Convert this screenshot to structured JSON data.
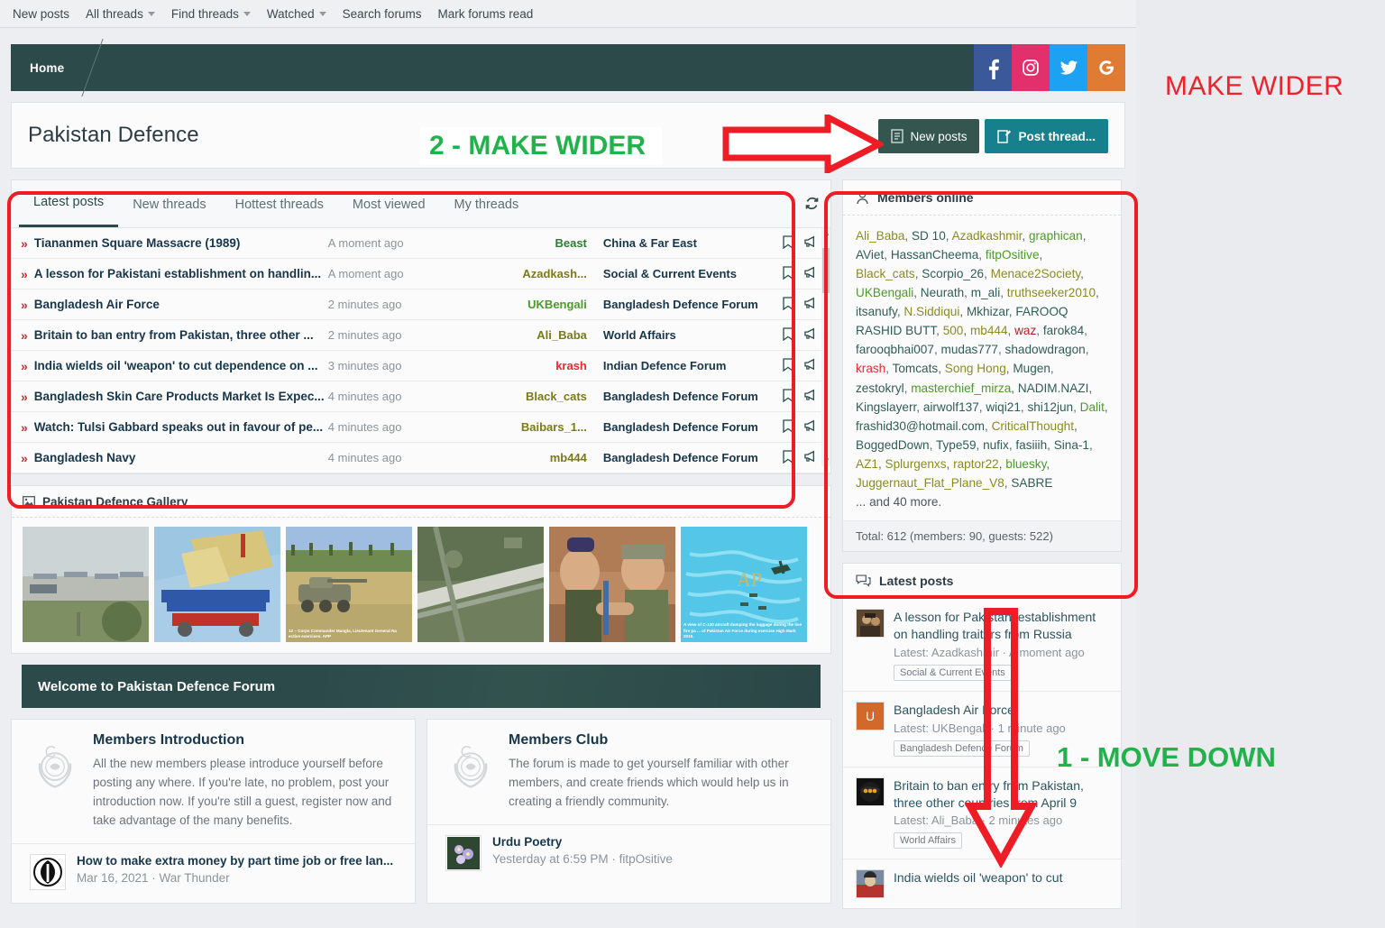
{
  "topnav": {
    "items": [
      {
        "label": "New posts",
        "caret": false
      },
      {
        "label": "All threads",
        "caret": true
      },
      {
        "label": "Find threads",
        "caret": true
      },
      {
        "label": "Watched",
        "caret": true
      },
      {
        "label": "Search forums",
        "caret": false
      },
      {
        "label": "Mark forums read",
        "caret": false
      }
    ]
  },
  "breadcrumb": {
    "home": "Home"
  },
  "socials": [
    {
      "name": "facebook",
      "glyph": "f",
      "color": "#3b5998"
    },
    {
      "name": "instagram",
      "glyph": "",
      "color": "#e1306c"
    },
    {
      "name": "twitter",
      "glyph": "",
      "color": "#1da1f2"
    },
    {
      "name": "google",
      "glyph": "G",
      "color": "#e07b33"
    }
  ],
  "header": {
    "title": "Pakistan Defence",
    "new_posts_label": "New posts",
    "post_thread_label": "Post thread..."
  },
  "tabs": [
    {
      "label": "Latest posts",
      "active": true
    },
    {
      "label": "New threads",
      "active": false
    },
    {
      "label": "Hottest threads",
      "active": false
    },
    {
      "label": "Most viewed",
      "active": false
    },
    {
      "label": "My threads",
      "active": false
    }
  ],
  "threads": [
    {
      "title": "Tiananmen Square Massacre (1989)",
      "time": "A moment ago",
      "user": "Beast",
      "user_color": "#2e7d32",
      "forum": "China & Far East"
    },
    {
      "title": "A lesson for Pakistani establishment on handlin...",
      "time": "A moment ago",
      "user": "Azadkash...",
      "user_color": "#7a7b18",
      "forum": "Social & Current Events"
    },
    {
      "title": "Bangladesh Air Force",
      "time": "2 minutes ago",
      "user": "UKBengali",
      "user_color": "#4c9a2a",
      "forum": "Bangladesh Defence Forum"
    },
    {
      "title": "Britain to ban entry from Pakistan, three other ...",
      "time": "2 minutes ago",
      "user": "Ali_Baba",
      "user_color": "#7a7b18",
      "forum": "World Affairs"
    },
    {
      "title": "India wields oil 'weapon' to cut dependence on ...",
      "time": "3 minutes ago",
      "user": "krash",
      "user_color": "#e8292f",
      "forum": "Indian Defence Forum"
    },
    {
      "title": "Bangladesh Skin Care Products Market Is Expec...",
      "time": "4 minutes ago",
      "user": "Black_cats",
      "user_color": "#7a7b18",
      "forum": "Bangladesh Defence Forum"
    },
    {
      "title": "Watch: Tulsi Gabbard speaks out in favour of pe...",
      "time": "4 minutes ago",
      "user": "Baibars_1...",
      "user_color": "#7a7b18",
      "forum": "Bangladesh Defence Forum"
    },
    {
      "title": "Bangladesh Navy",
      "time": "4 minutes ago",
      "user": "mb444",
      "user_color": "#7a7b18",
      "forum": "Bangladesh Defence Forum"
    }
  ],
  "gallery": {
    "title": "Pakistan Defence Gallery",
    "items": [
      {
        "caption": ""
      },
      {
        "caption": ""
      },
      {
        "caption": "12 – Corps Commander Mangla, Lieutenant General Na ective exercises. APP"
      },
      {
        "caption": ""
      },
      {
        "caption": ""
      },
      {
        "caption": "A view of C-130 aircraft dumping the luggage during the live fire pa ... of Pakistan Air Force during exercise High Mark 2010."
      }
    ]
  },
  "welcome": {
    "title": "Welcome to Pakistan Defence Forum"
  },
  "bottom_cards": [
    {
      "title": "Members Introduction",
      "desc": "All the new members please introduce yourself before posting any where. If you're late, no problem, post your introduction now. If you're still a guest, register now and take advantage of the many benefits.",
      "footer_title": "How to make extra money by part time job or free lan...",
      "footer_meta": "Mar 16, 2021 · War Thunder"
    },
    {
      "title": "Members Club",
      "desc": "The forum is made to get yourself familiar with other members, and create friends which would help us in creating a friendly community.",
      "footer_title": "Urdu Poetry",
      "footer_meta": "Yesterday at 6:59 PM · fitpOsitive"
    }
  ],
  "members_online": {
    "title": "Members online",
    "members": [
      {
        "n": "Ali_Baba",
        "c": "#8a8c1e"
      },
      {
        "n": "SD 10",
        "c": "#2f5e52"
      },
      {
        "n": "Azadkashmir",
        "c": "#8a8c1e"
      },
      {
        "n": "graphican",
        "c": "#4c9a2a"
      },
      {
        "n": "AViet",
        "c": "#2f5e52"
      },
      {
        "n": "HassanCheema",
        "c": "#2f5e52"
      },
      {
        "n": "fitpOsitive",
        "c": "#4c9a2a"
      },
      {
        "n": "Black_cats",
        "c": "#8a8c1e"
      },
      {
        "n": "Scorpio_26",
        "c": "#2f5e52"
      },
      {
        "n": "Menace2Society",
        "c": "#8a8c1e"
      },
      {
        "n": "UKBengali",
        "c": "#4c9a2a"
      },
      {
        "n": "Neurath",
        "c": "#2f5e52"
      },
      {
        "n": "m_ali",
        "c": "#2f5e52"
      },
      {
        "n": "truthseeker2010",
        "c": "#8a8c1e"
      },
      {
        "n": "itsanufy",
        "c": "#2f5e52"
      },
      {
        "n": "N.Siddiqui",
        "c": "#8a8c1e"
      },
      {
        "n": "Mkhizar",
        "c": "#2f5e52"
      },
      {
        "n": "FAROOQ RASHID BUTT",
        "c": "#2f5e52"
      },
      {
        "n": "500",
        "c": "#8a8c1e"
      },
      {
        "n": "mb444",
        "c": "#8a8c1e"
      },
      {
        "n": "waz",
        "c": "#b01f24"
      },
      {
        "n": "farok84",
        "c": "#2f5e52"
      },
      {
        "n": "farooqbhai007",
        "c": "#2f5e52"
      },
      {
        "n": "mudas777",
        "c": "#2f5e52"
      },
      {
        "n": "shadowdragon",
        "c": "#2f5e52"
      },
      {
        "n": "krash",
        "c": "#e8292f"
      },
      {
        "n": "Tomcats",
        "c": "#2f5e52"
      },
      {
        "n": "Song Hong",
        "c": "#8a8c1e"
      },
      {
        "n": "Mugen",
        "c": "#2f5e52"
      },
      {
        "n": "zestokryl",
        "c": "#2f5e52"
      },
      {
        "n": "masterchief_mirza",
        "c": "#4c9a2a"
      },
      {
        "n": "NADIM.NAZI",
        "c": "#2f5e52"
      },
      {
        "n": "Kingslayerr",
        "c": "#2f5e52"
      },
      {
        "n": "airwolf137",
        "c": "#2f5e52"
      },
      {
        "n": "wiqi21",
        "c": "#2f5e52"
      },
      {
        "n": "shi12jun",
        "c": "#2f5e52"
      },
      {
        "n": "Dalit",
        "c": "#4c9a2a"
      },
      {
        "n": "frashid30@hotmail.com",
        "c": "#2f5e52"
      },
      {
        "n": "CriticalThought",
        "c": "#8a8c1e"
      },
      {
        "n": "BoggedDown",
        "c": "#2f5e52"
      },
      {
        "n": "Type59",
        "c": "#2f5e52"
      },
      {
        "n": "nufix",
        "c": "#2f5e52"
      },
      {
        "n": "fasiiih",
        "c": "#2f5e52"
      },
      {
        "n": "Sina-1",
        "c": "#2f5e52"
      },
      {
        "n": "AZ1",
        "c": "#8a8c1e"
      },
      {
        "n": "Splurgenxs",
        "c": "#8a8c1e"
      },
      {
        "n": "raptor22",
        "c": "#8a8c1e"
      },
      {
        "n": "bluesky",
        "c": "#4c9a2a"
      },
      {
        "n": "Juggernaut_Flat_Plane_V8",
        "c": "#8a8c1e"
      },
      {
        "n": "SABRE",
        "c": "#2f5e52"
      }
    ],
    "more": "... and 40 more.",
    "total": "Total: 612 (members: 90, guests: 522)"
  },
  "latest_posts": {
    "title": "Latest posts",
    "items": [
      {
        "title": "A lesson for Pakistani establishment on handling traitors from Russia",
        "meta": "Latest: Azadkashmir · A moment ago",
        "tag": "Social & Current Events",
        "av_type": "img",
        "av_letter": "",
        "av_color": "#6b5138"
      },
      {
        "title": "Bangladesh Air Force",
        "meta": "Latest: UKBengali · 1 minute ago",
        "tag": "Bangladesh Defence Forum",
        "av_type": "letter",
        "av_letter": "U",
        "av_color": "#d2692a"
      },
      {
        "title": "Britain to ban entry from Pakistan, three other countries from April 9",
        "meta": "Latest: Ali_Baba · 2 minutes ago",
        "tag": "World Affairs",
        "av_type": "img",
        "av_letter": "",
        "av_color": "#1a1a1a"
      },
      {
        "title": "India wields oil 'weapon' to cut",
        "meta": "",
        "tag": "",
        "av_type": "img",
        "av_letter": "",
        "av_color": "#9e2b2b"
      }
    ]
  },
  "annotations": {
    "make_wider_top": "MAKE WIDER",
    "make_wider_title": "2 - MAKE WIDER",
    "move_down": "1 - MOVE DOWN"
  }
}
